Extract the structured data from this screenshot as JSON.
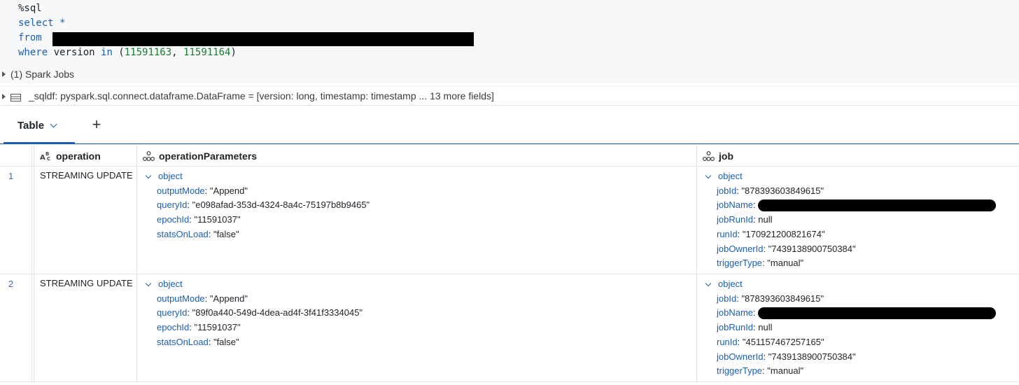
{
  "code": {
    "line1": "%sql",
    "line2": "select *",
    "line3_kw": "from",
    "line4_kw1": "where",
    "line4_mid": " version ",
    "line4_kw2": "in",
    "line4_open": " (",
    "line4_n1": "11591163",
    "line4_comma": ", ",
    "line4_n2": "11591164",
    "line4_close": ")"
  },
  "spark_jobs": "(1) Spark Jobs",
  "sqldf": "_sqldf:  pyspark.sql.connect.dataframe.DataFrame = [version: long, timestamp: timestamp ... 13 more fields]",
  "tabs": {
    "active": "Table",
    "add": "+"
  },
  "columns": {
    "operation": "operation",
    "operationParameters": "operationParameters",
    "job": "job"
  },
  "rows": [
    {
      "num": "1",
      "operation": "STREAMING UPDATE",
      "params": {
        "label": "object",
        "outputMode_k": "outputMode",
        "outputMode_v": "\"Append\"",
        "queryId_k": "queryId",
        "queryId_v": "\"e098afad-353d-4324-8a4c-75197b8b9465\"",
        "epochId_k": "epochId",
        "epochId_v": "\"11591037\"",
        "statsOnLoad_k": "statsOnLoad",
        "statsOnLoad_v": "\"false\""
      },
      "job": {
        "label": "object",
        "jobId_k": "jobId",
        "jobId_v": "\"878393603849615\"",
        "jobName_k": "jobName",
        "jobRunId_k": "jobRunId",
        "jobRunId_v": "null",
        "runId_k": "runId",
        "runId_v": "\"170921200821674\"",
        "jobOwnerId_k": "jobOwnerId",
        "jobOwnerId_v": "\"7439138900750384\"",
        "triggerType_k": "triggerType",
        "triggerType_v": "\"manual\""
      }
    },
    {
      "num": "2",
      "operation": "STREAMING UPDATE",
      "params": {
        "label": "object",
        "outputMode_k": "outputMode",
        "outputMode_v": "\"Append\"",
        "queryId_k": "queryId",
        "queryId_v": "\"89f0a440-549d-4dea-ad4f-3f41f3334045\"",
        "epochId_k": "epochId",
        "epochId_v": "\"11591037\"",
        "statsOnLoad_k": "statsOnLoad",
        "statsOnLoad_v": "\"false\""
      },
      "job": {
        "label": "object",
        "jobId_k": "jobId",
        "jobId_v": "\"878393603849615\"",
        "jobName_k": "jobName",
        "jobRunId_k": "jobRunId",
        "jobRunId_v": "null",
        "runId_k": "runId",
        "runId_v": "\"451157467257165\"",
        "jobOwnerId_k": "jobOwnerId",
        "jobOwnerId_v": "\"7439138900750384\"",
        "triggerType_k": "triggerType",
        "triggerType_v": "\"manual\""
      }
    }
  ],
  "colors": {
    "accent": "#1a5fb4",
    "number": "#1b7a2e",
    "code_bg": "#f7f8f9"
  },
  "icons": [
    "caret-right-icon",
    "table-icon",
    "chevron-down-icon",
    "plus-icon",
    "string-type-icon",
    "struct-type-icon"
  ]
}
